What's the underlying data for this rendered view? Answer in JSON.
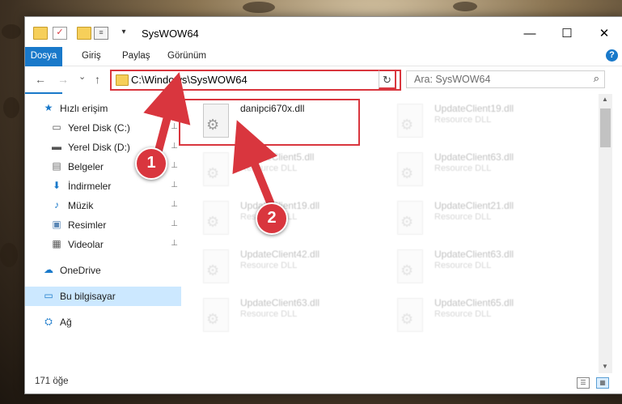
{
  "window": {
    "title": "SysWOW64",
    "icons": [
      "folder-icon",
      "properties-check-icon",
      "new-folder-icon",
      "view-options-icon",
      "dropdown-arrow-icon"
    ],
    "controls": {
      "minimize": "—",
      "maximize": "☐",
      "close": "✕"
    }
  },
  "ribbon": {
    "tabs": [
      "Dosya",
      "Giriş",
      "Paylaş",
      "Görünüm"
    ],
    "help": "?"
  },
  "nav": {
    "back": "←",
    "forward": "→",
    "recent": "⌄",
    "up": "↑",
    "address": "C:\\Windows\\SysWOW64",
    "address_dropdown": "⌄",
    "refresh": "↻",
    "search_placeholder": "Ara: SysWOW64",
    "search_icon": "⌕"
  },
  "sidebar": {
    "items": [
      {
        "label": "Hızlı erişim",
        "icon": "star-icon",
        "glyph": "★",
        "color": "#1979ca",
        "pinned": false
      },
      {
        "label": "Yerel Disk (C:)",
        "icon": "drive-windows-icon",
        "glyph": "▭",
        "color": "#555555",
        "pinned": true
      },
      {
        "label": "Yerel Disk (D:)",
        "icon": "drive-icon",
        "glyph": "▬",
        "color": "#555555",
        "pinned": true
      },
      {
        "label": "Belgeler",
        "icon": "documents-icon",
        "glyph": "▤",
        "color": "#6a6a6a",
        "pinned": true
      },
      {
        "label": "İndirmeler",
        "icon": "downloads-icon",
        "glyph": "⬇",
        "color": "#1979ca",
        "pinned": true
      },
      {
        "label": "Müzik",
        "icon": "music-icon",
        "glyph": "♪",
        "color": "#1979ca",
        "pinned": true
      },
      {
        "label": "Resimler",
        "icon": "pictures-icon",
        "glyph": "▣",
        "color": "#5a87b5",
        "pinned": true
      },
      {
        "label": "Videolar",
        "icon": "videos-icon",
        "glyph": "▦",
        "color": "#555555",
        "pinned": true
      },
      {
        "label": "OneDrive",
        "icon": "cloud-icon",
        "glyph": "☁",
        "color": "#1979ca",
        "pinned": false
      },
      {
        "label": "Bu bilgisayar",
        "icon": "computer-icon",
        "glyph": "▭",
        "color": "#1979ca",
        "pinned": false,
        "selected": true
      },
      {
        "label": "Ağ",
        "icon": "network-icon",
        "glyph": "⛭",
        "color": "#1979ca",
        "pinned": false
      }
    ],
    "pin_glyph": "📌"
  },
  "files": {
    "left": [
      {
        "name": "danipci670x.dll",
        "type": "",
        "faded": false
      },
      {
        "name": "UpdateClient5.dll",
        "type": "Resource DLL",
        "faded": true
      },
      {
        "name": "UpdateClient19.dll",
        "type": "Resource DLL",
        "faded": true
      },
      {
        "name": "UpdateClient42.dll",
        "type": "Resource DLL",
        "faded": true
      },
      {
        "name": "UpdateClient63.dll",
        "type": "Resource DLL",
        "faded": true
      }
    ],
    "right": [
      {
        "name": "UpdateClient19.dll",
        "type": "Resource DLL",
        "faded": true
      },
      {
        "name": "UpdateClient63.dll",
        "type": "Resource DLL",
        "faded": true
      },
      {
        "name": "UpdateClient21.dll",
        "type": "Resource DLL",
        "faded": true
      },
      {
        "name": "UpdateClient63.dll",
        "type": "Resource DLL",
        "faded": true
      },
      {
        "name": "UpdateClient65.dll",
        "type": "Resource DLL",
        "faded": true
      }
    ],
    "gear_glyph": "⚙"
  },
  "status": {
    "item_count": "171 öğe"
  },
  "annotations": {
    "step1": "1",
    "step2": "2",
    "color": "#d9363e"
  }
}
